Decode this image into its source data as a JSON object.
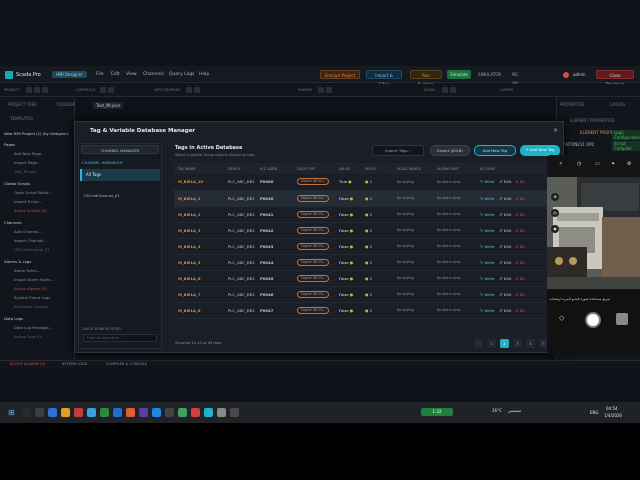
{
  "app": {
    "title": "Scada Pro",
    "subtitle": "HMI Designer",
    "badge": "HMI Designer",
    "menu": [
      "File",
      "Edit",
      "View",
      "Channels",
      "Query Logs",
      "Help"
    ],
    "btn_encrypt": "Encrypt Project",
    "btn_import": "Import & Sites",
    "btn_run": "Run Runtime",
    "btn_online": "Simulate",
    "simulation": "SIMULATOR",
    "status": "NS 0V",
    "user": "admin",
    "btn_close": "Close Designer"
  },
  "toolbar": {
    "labels": [
      "PROJECT",
      "CONTROLS",
      "INPUT/DISPLAY",
      "SHAPES",
      "ALIGN",
      "LAYERS"
    ]
  },
  "left_panel": {
    "headers": [
      "PROJECT TREE",
      "TOOLBOX"
    ],
    "sub_header": "TEMPLATES",
    "tab": "Text_Ml.json",
    "project": "New HMI Project (1) (by Designer)",
    "tree": [
      {
        "label": "Pages",
        "type": "sec"
      },
      {
        "label": "Add New Page...",
        "type": "item"
      },
      {
        "label": "Import Page...",
        "type": "item"
      },
      {
        "label": "Text_Ml.json",
        "type": "grey"
      },
      {
        "label": "Global Scripts",
        "type": "sec"
      },
      {
        "label": "Open Script Editor...",
        "type": "item"
      },
      {
        "label": "Import Script...",
        "type": "item"
      },
      {
        "label": "Active Scripts (0)",
        "type": "red"
      },
      {
        "label": "Channels",
        "type": "sec"
      },
      {
        "label": "Add Channel...",
        "type": "item"
      },
      {
        "label": "Import Channel...",
        "type": "item"
      },
      {
        "label": "LSCnetChannel_01",
        "type": "grey"
      },
      {
        "label": "Alarms & Logs",
        "type": "sec"
      },
      {
        "label": "Alarm Rules...",
        "type": "item"
      },
      {
        "label": "Import Alarm Rules...",
        "type": "item"
      },
      {
        "label": "Active Alarms (0)",
        "type": "red"
      },
      {
        "label": "System Event Logs",
        "type": "item"
      },
      {
        "label": "Simulator Console",
        "type": "grey"
      },
      {
        "label": "Data Logs",
        "type": "sec"
      },
      {
        "label": "Data Log Manager...",
        "type": "item"
      },
      {
        "label": "Active Logs (0)",
        "type": "grey"
      }
    ]
  },
  "right_panel": {
    "headers": [
      "PROPERTIES",
      "LAYERS"
    ],
    "sub_header": "ELEMENT PROPERTIES",
    "device": "ANTONI/11 OPC",
    "tag1": "Logic Configuration",
    "tag2": "Script Compiler"
  },
  "bottom_bar": [
    "ACTIVE ALARMS (0)",
    "SYSTEM LOGS",
    "COMPILER & CONSOLE"
  ],
  "modal": {
    "title": "Tag & Variable Database Manager",
    "channel_btn": "CHANNEL MANAGER",
    "hierarchy": "CHANNEL HIERARCHY",
    "all_tags": "All Tags",
    "channel": "LSCnetChannel_01",
    "quick_search": "QUICK SEARCH FILTER",
    "search_placeholder": "Filter by tag name...",
    "section_title": "Tags in Active Database",
    "section_sub": "Select a specific Group node to display its tags",
    "import_dropdown": "Import Tags...",
    "btn_export": "Export (JSON)",
    "btn_add_row": "Add New Tag",
    "btn_add": "+ Add New Tag",
    "columns": [
      "TAG NAME",
      "DEVICE",
      "PLC ADDR",
      "DATA TYPE",
      "VALUE",
      "RESOL.",
      "SCALE RANGE",
      "ALARM LIMIT",
      "ACTIONS"
    ],
    "rows": [
      {
        "name": "M_BIELA_10",
        "device": "PLC_XBC_DR1",
        "addr": "P0060",
        "type": "Digital (BOOL)",
        "value": "True",
        "resol": "1",
        "scale": "No Scaling",
        "alarm": "No Alarm Limit"
      },
      {
        "name": "M_BIELA_1",
        "device": "PLC_XBC_DR1",
        "addr": "P0040",
        "type": "Digital (BOOL)",
        "value": "False",
        "resol": "1",
        "scale": "No Scaling",
        "alarm": "No Alarm Limit"
      },
      {
        "name": "M_BIELA_2",
        "device": "PLC_XBC_DR1",
        "addr": "P0041",
        "type": "Digital (BOOL)",
        "value": "False",
        "resol": "1",
        "scale": "No Scaling",
        "alarm": "No Alarm Limit"
      },
      {
        "name": "M_BIELA_3",
        "device": "PLC_XBC_DR1",
        "addr": "P0042",
        "type": "Digital (BOOL)",
        "value": "False",
        "resol": "1",
        "scale": "No Scaling",
        "alarm": "No Alarm Limit"
      },
      {
        "name": "M_BIELA_4",
        "device": "PLC_XBC_DR1",
        "addr": "P0043",
        "type": "Digital (BOOL)",
        "value": "False",
        "resol": "1",
        "scale": "No Scaling",
        "alarm": "No Alarm Limit"
      },
      {
        "name": "M_BIELA_5",
        "device": "PLC_XBC_DR1",
        "addr": "P0044",
        "type": "Digital (BOOL)",
        "value": "False",
        "resol": "1",
        "scale": "No Scaling",
        "alarm": "No Alarm Limit"
      },
      {
        "name": "M_BIELA_6",
        "device": "PLC_XBC_DR1",
        "addr": "P0045",
        "type": "Digital (BOOL)",
        "value": "False",
        "resol": "1",
        "scale": "No Scaling",
        "alarm": "No Alarm Limit"
      },
      {
        "name": "M_BIELA_7",
        "device": "PLC_XBC_DR1",
        "addr": "P0046",
        "type": "Digital (BOOL)",
        "value": "False",
        "resol": "1",
        "scale": "No Scaling",
        "alarm": "No Alarm Limit"
      },
      {
        "name": "M_BIELA_8",
        "device": "PLC_XBC_DR1",
        "addr": "P0047",
        "type": "Digital (BOOL)",
        "value": "False",
        "resol": "1",
        "scale": "No Scaling",
        "alarm": "No Alarm Limit"
      }
    ],
    "action_write": "Write",
    "action_edit": "Edit",
    "action_del": "De",
    "showing": "Showing 10-10 of 49 tags",
    "pages": [
      "‹",
      "1",
      "2",
      "3",
      "4",
      "5",
      "›"
    ],
    "active_page": "2"
  },
  "phone": {
    "caption": "سريع  مساعدة  صورة  فيديو  المزيد  اوصفات"
  },
  "taskbar": {
    "weather": "26°C",
    "weather_txt": "مشمس",
    "lang": "ENG",
    "time": "04:54",
    "date": "1/4/2026",
    "app_tag": "1:32"
  },
  "colors": {
    "accent": "#1fb2c8",
    "orange": "#e08a3c",
    "danger": "#d24d4d"
  }
}
